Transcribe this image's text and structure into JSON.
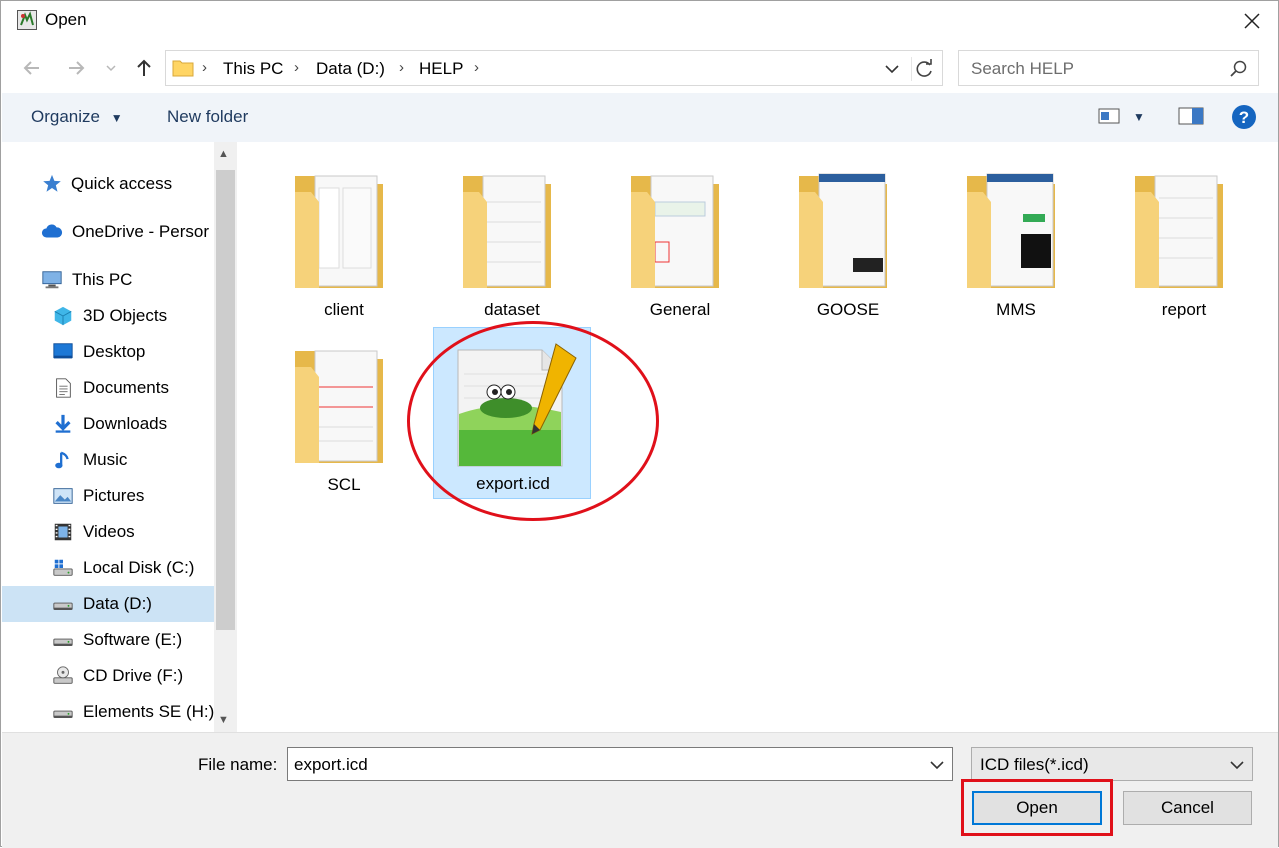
{
  "window": {
    "title": "Open"
  },
  "nav": {
    "crumbs": [
      "This PC",
      "Data (D:)",
      "HELP"
    ],
    "search_placeholder": "Search HELP"
  },
  "toolbar": {
    "organize": "Organize",
    "new_folder": "New folder"
  },
  "sidebar": {
    "items": [
      {
        "label": "Quick access",
        "icon": "star-icon"
      },
      {
        "label": "OneDrive - Persor",
        "icon": "cloud-icon"
      },
      {
        "label": "This PC",
        "icon": "computer-icon"
      },
      {
        "label": "3D Objects",
        "icon": "cube-icon"
      },
      {
        "label": "Desktop",
        "icon": "desktop-icon"
      },
      {
        "label": "Documents",
        "icon": "document-icon"
      },
      {
        "label": "Downloads",
        "icon": "download-icon"
      },
      {
        "label": "Music",
        "icon": "music-icon"
      },
      {
        "label": "Pictures",
        "icon": "picture-icon"
      },
      {
        "label": "Videos",
        "icon": "video-icon"
      },
      {
        "label": "Local Disk (C:)",
        "icon": "drive-windows-icon"
      },
      {
        "label": "Data (D:)",
        "icon": "drive-icon",
        "selected": true
      },
      {
        "label": "Software (E:)",
        "icon": "drive-icon"
      },
      {
        "label": "CD Drive (F:)",
        "icon": "cd-drive-icon"
      },
      {
        "label": "Elements SE (H:)",
        "icon": "drive-icon"
      }
    ]
  },
  "files": [
    {
      "name": "client",
      "type": "folder"
    },
    {
      "name": "dataset",
      "type": "folder"
    },
    {
      "name": "General",
      "type": "folder"
    },
    {
      "name": "GOOSE",
      "type": "folder"
    },
    {
      "name": "MMS",
      "type": "folder"
    },
    {
      "name": "report",
      "type": "folder"
    },
    {
      "name": "SCL",
      "type": "folder"
    },
    {
      "name": "export.icd",
      "type": "notepad-file",
      "selected": true
    }
  ],
  "bottom": {
    "file_name_label": "File name:",
    "file_name_value": "export.icd",
    "file_type": "ICD files(*.icd)",
    "open_label": "Open",
    "cancel_label": "Cancel"
  },
  "colors": {
    "highlight": "#e0101a",
    "selection": "#cce8ff",
    "accent": "#0078d7"
  }
}
